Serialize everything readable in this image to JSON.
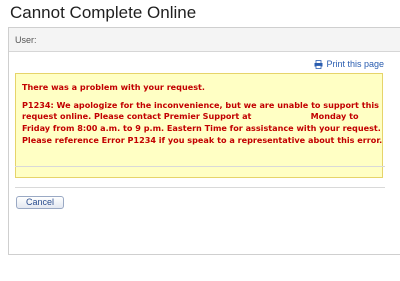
{
  "page": {
    "title": "Cannot Complete Online"
  },
  "header": {
    "user_label": "User:"
  },
  "toolbar": {
    "print_label": "Print this page",
    "print_icon": "print-icon"
  },
  "error": {
    "title": "There was a problem with your request.",
    "message": "P1234: We apologize for the inconvenience, but we are unable to support this request online. Please contact Premier Support at                     Monday to Friday from 8:00 a.m. to 9 p.m. Eastern Time for assistance with your request. Please reference Error P1234 if you speak to a representative about this error.",
    "background_color": "#ffffc4",
    "text_color": "#c20000"
  },
  "actions": {
    "cancel_label": "Cancel"
  }
}
